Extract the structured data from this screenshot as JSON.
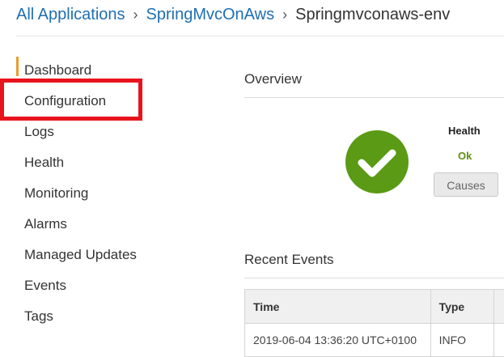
{
  "breadcrumb": {
    "items": [
      {
        "label": "All Applications"
      },
      {
        "label": "SpringMvcOnAws"
      },
      {
        "label": "Springmvconaws-env"
      }
    ],
    "separator": "›"
  },
  "sidebar": {
    "items": [
      {
        "label": "Dashboard"
      },
      {
        "label": "Configuration"
      },
      {
        "label": "Logs"
      },
      {
        "label": "Health"
      },
      {
        "label": "Monitoring"
      },
      {
        "label": "Alarms"
      },
      {
        "label": "Managed Updates"
      },
      {
        "label": "Events"
      },
      {
        "label": "Tags"
      }
    ]
  },
  "overview": {
    "title": "Overview",
    "health": {
      "label": "Health",
      "value": "Ok",
      "causes_button": "Causes",
      "icon": "check-icon",
      "color": "#5a9a14"
    }
  },
  "recent_events": {
    "title": "Recent Events",
    "columns": [
      "Time",
      "Type"
    ],
    "rows": [
      {
        "time": "2019-06-04 13:36:20 UTC+0100",
        "type": "INFO"
      }
    ]
  },
  "colors": {
    "link": "#1f6fb2",
    "active_indicator": "#e99c2b",
    "highlight": "#e8141d",
    "ok_green": "#5a9a14"
  }
}
